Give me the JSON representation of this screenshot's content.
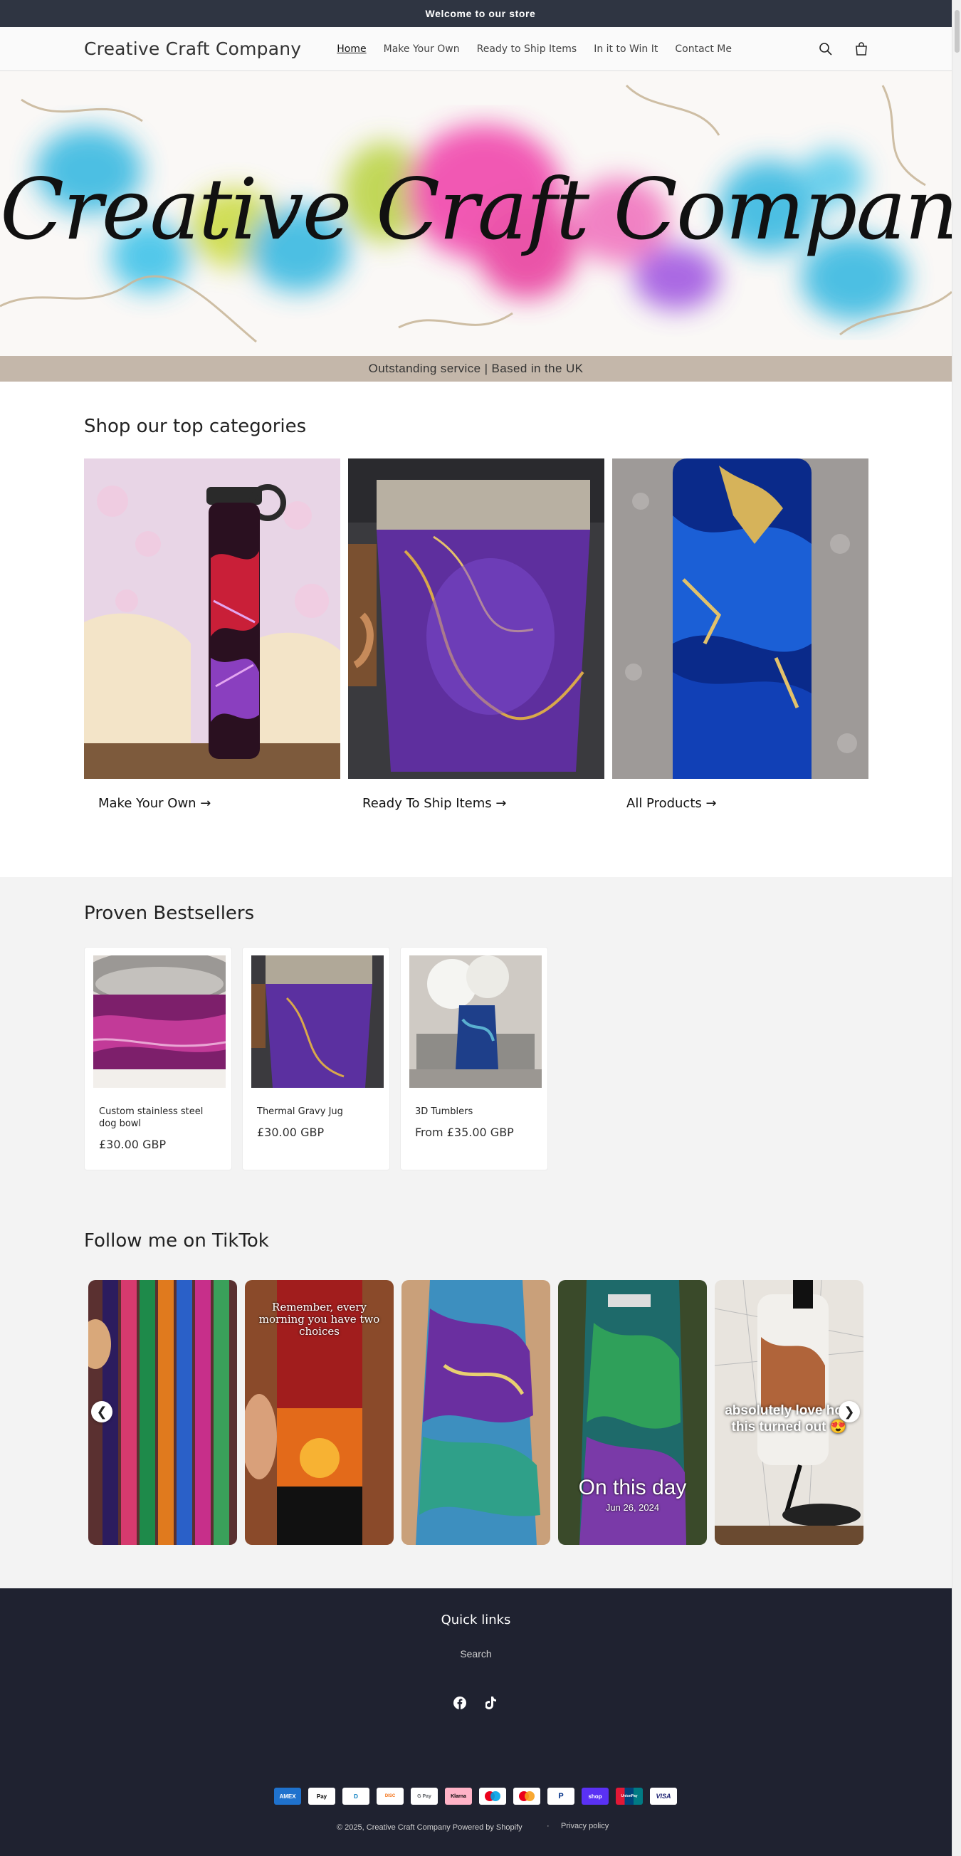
{
  "announcement": "Welcome to our store",
  "header": {
    "brand": "Creative Craft Company",
    "nav": [
      "Home",
      "Make Your Own",
      "Ready to Ship Items",
      "In it to Win It",
      "Contact Me"
    ],
    "search_icon": "search-icon",
    "cart_icon": "cart-icon"
  },
  "hero": {
    "script_text": "Creative Craft Company",
    "strip_text": "Outstanding service | Based in the UK"
  },
  "categories": {
    "title": "Shop our top categories",
    "items": [
      "Make Your Own →",
      "Ready To Ship Items →",
      "All Products →"
    ]
  },
  "bestsellers": {
    "title": "Proven Bestsellers",
    "products": [
      {
        "name": "Custom stainless steel dog bowl",
        "price": "£30.00 GBP"
      },
      {
        "name": "Thermal Gravy Jug",
        "price": "£30.00 GBP"
      },
      {
        "name": "3D Tumblers",
        "price": "From £35.00 GBP"
      }
    ]
  },
  "tiktok": {
    "title": "Follow me on TikTok",
    "overlay_2": "Remember, every morning you have two choices",
    "overlay_4_title": "On this day",
    "overlay_4_date": "Jun 26, 2024",
    "overlay_5": "absolutely love how this turned out 😍",
    "prev_icon": "❮",
    "next_icon": "❯"
  },
  "footer": {
    "quick_links_title": "Quick links",
    "search_link": "Search",
    "payments": [
      "AMEX",
      "Pay",
      "D",
      "DISC",
      "G Pay",
      "Klarna",
      "",
      "",
      "P",
      "shop",
      "UnionPay",
      "VISA"
    ],
    "payment_colors": [
      "#1f72cd",
      "#ffffff",
      "#ffffff",
      "#ffffff",
      "#ffffff",
      "#ffb3c7",
      "#ffffff",
      "#ffffff",
      "#ffffff",
      "#5a31f4",
      "#ffffff",
      "#ffffff"
    ],
    "copyright": "© 2025, Creative Craft Company Powered by Shopify",
    "privacy": "Privacy policy"
  }
}
